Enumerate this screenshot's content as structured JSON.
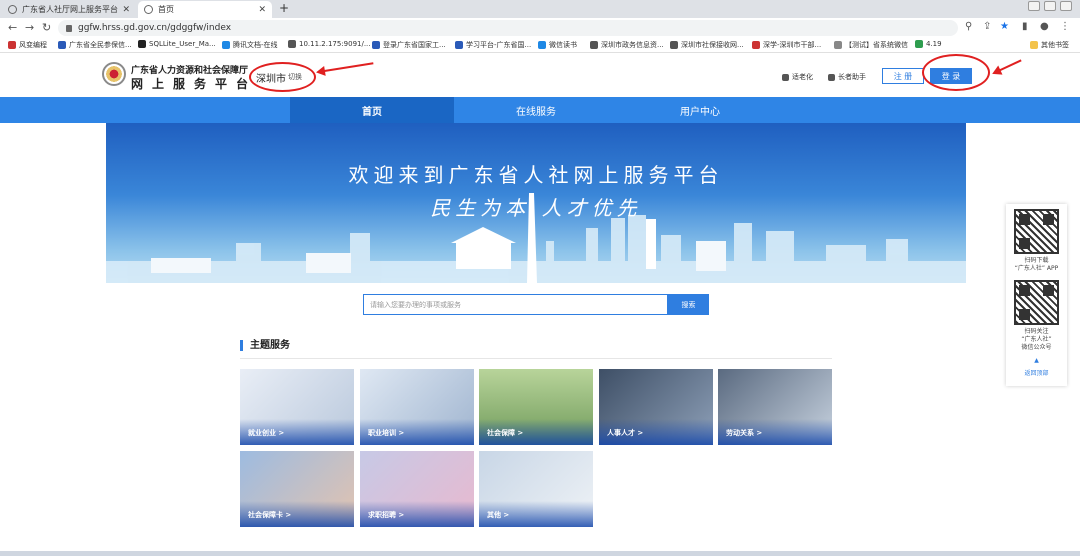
{
  "browser": {
    "tabs": [
      {
        "title": "广东省人社厅网上服务平台",
        "active": false
      },
      {
        "title": "首页",
        "active": true
      }
    ],
    "url": "ggfw.hrss.gd.gov.cn/gdggfw/index",
    "bookmarks": [
      "风变编程",
      "广东省全民参保信...",
      "SQLLite_User_Ma...",
      "腾讯文档-在线",
      "10.11.2.175:9091/...",
      "登录广东省国家工...",
      "学习平台-广东省国...",
      "微信读书",
      "深圳市政务信息资...",
      "深圳市社保接收网...",
      "深学-深圳市干部...",
      "【测试】省系统微信",
      "4.19"
    ],
    "other_bookmarks": "其他书签"
  },
  "header": {
    "org_name": "广东省人力资源和社会保障厅",
    "platform_name": "网上服务平台",
    "city": "深圳市",
    "switch_label": "切换",
    "elderly_mode": "适老化",
    "elder_assistant": "长者助手",
    "register": "注 册",
    "login": "登 录"
  },
  "nav": [
    "首页",
    "在线服务",
    "用户中心"
  ],
  "banner": {
    "title": "欢迎来到广东省人社网上服务平台",
    "slogan": "民生为本   人才优先"
  },
  "search": {
    "placeholder": "请输入您要办理的事项或服务",
    "button": "搜索"
  },
  "section": {
    "title": "主题服务",
    "cards": [
      "就业创业 >",
      "职业培训 >",
      "社会保障 >",
      "人事人才 >",
      "劳动关系 >",
      "社会保障卡 >",
      "求职招聘 >",
      "其他 >"
    ]
  },
  "float": {
    "app_text": [
      "扫码下载",
      "“广东人社” APP"
    ],
    "wechat_text": [
      "扫码关注",
      "“广东人社”",
      "微信公众号"
    ],
    "back_top": "返回顶部"
  },
  "colors": {
    "primary": "#2f7ee0",
    "nav": "#2f85e6",
    "annotation": "#e02020"
  }
}
